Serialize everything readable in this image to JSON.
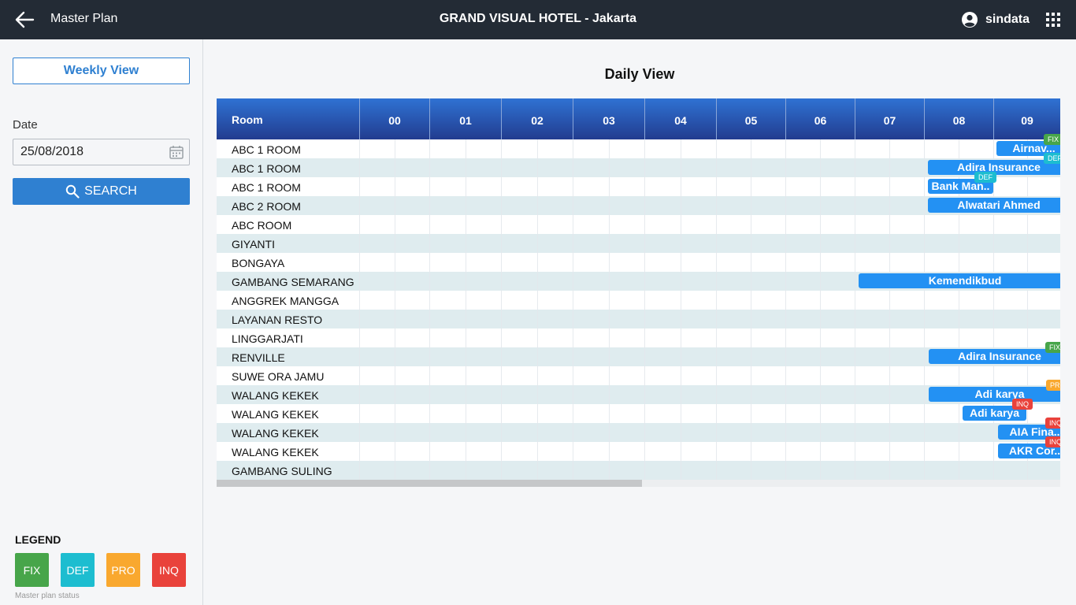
{
  "topbar": {
    "app_title": "Master Plan",
    "hotel_title": "GRAND VISUAL HOTEL - Jakarta",
    "user_name": "sindata"
  },
  "sidebar": {
    "weekly_view_label": "Weekly View",
    "date_label": "Date",
    "date_value": "25/08/2018",
    "search_label": "SEARCH",
    "legend_title": "LEGEND",
    "legend_items": [
      {
        "label": "FIX",
        "color": "#47a54a"
      },
      {
        "label": "DEF",
        "color": "#1dbdd0"
      },
      {
        "label": "PRO",
        "color": "#f9a82f"
      },
      {
        "label": "INQ",
        "color": "#e9423b"
      }
    ],
    "legend_note": "Master plan status"
  },
  "main": {
    "title": "Daily View",
    "room_header": "Room",
    "hours": [
      "00",
      "01",
      "02",
      "03",
      "04",
      "05",
      "06",
      "07",
      "08",
      "09"
    ],
    "rooms": [
      "ABC 1 ROOM",
      "ABC 1 ROOM",
      "ABC 1 ROOM",
      "ABC 2 ROOM",
      "ABC ROOM",
      "GIYANTI",
      "BONGAYA",
      "GAMBANG SEMARANG",
      "ANGGREK MANGGA",
      "LAYANAN RESTO",
      "LINGGARJATI",
      "RENVILLE",
      "SUWE ORA JAMU",
      "WALANG KEKEK",
      "WALANG KEKEK",
      "WALANG KEKEK",
      "WALANG KEKEK",
      "GAMBANG SULING"
    ],
    "bookings": [
      {
        "label": "Airnav...",
        "status": "FIX",
        "tag_text": "FIX"
      },
      {
        "label": "Adira Insurance",
        "status": "DEF",
        "tag_text": "DEF"
      },
      {
        "label": "Bank Man..",
        "status": "DEF",
        "tag_text": "DEF"
      },
      {
        "label": "Alwatari Ahmed",
        "status": "",
        "tag_text": ""
      },
      {
        "label": "Kemendikbud",
        "status": "",
        "tag_text": ""
      },
      {
        "label": "Adira Insurance",
        "status": "FIX",
        "tag_text": "FIX"
      },
      {
        "label": "Adi karya",
        "status": "PRO",
        "tag_text": "PRO"
      },
      {
        "label": "Adi karya",
        "status": "INQ",
        "tag_text": "INQ"
      },
      {
        "label": "AIA Fina..",
        "status": "INQ",
        "tag_text": "INQ"
      },
      {
        "label": "AKR Cor..",
        "status": "INQ",
        "tag_text": "INQ"
      }
    ]
  }
}
